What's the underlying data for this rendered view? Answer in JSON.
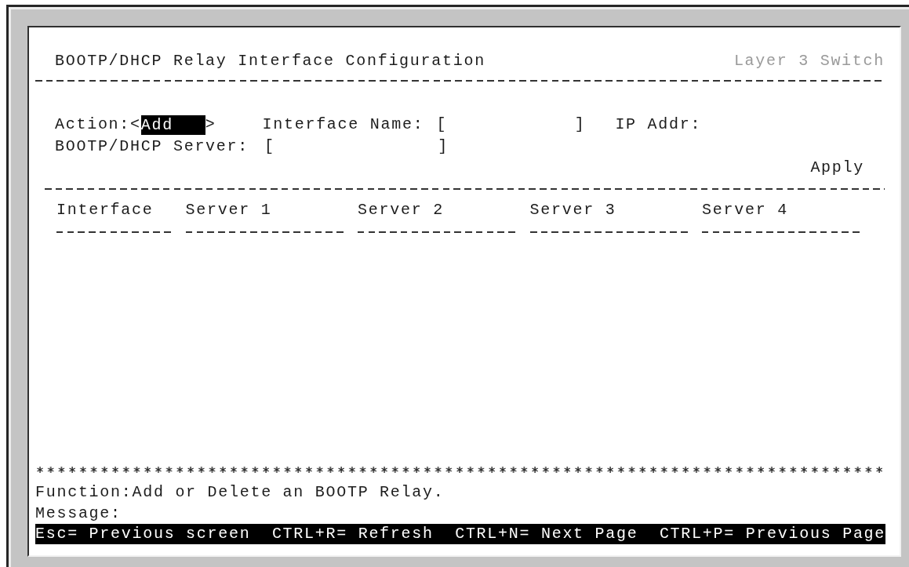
{
  "screen": {
    "title": "BOOTP/DHCP Relay Interface Configuration",
    "device": "Layer 3 Switch"
  },
  "form": {
    "action": {
      "label": "Action:",
      "open": "<",
      "value": "Add",
      "close": ">",
      "focused": true
    },
    "interface_name": {
      "label": "Interface Name:",
      "open_bracket": "[",
      "close_bracket": "]"
    },
    "ip_addr": {
      "label": "IP Addr:"
    },
    "server": {
      "label": "BOOTP/DHCP Server:",
      "open_bracket": "[",
      "close_bracket": "]"
    },
    "apply_button": "Apply"
  },
  "table": {
    "columns": [
      "Interface",
      "Server 1",
      "Server 2",
      "Server 3",
      "Server 4"
    ]
  },
  "function_text": "Function:Add or Delete an BOOTP Relay.",
  "message": {
    "label": "Message:"
  },
  "key_hints": [
    "Esc= Previous screen",
    "CTRL+R= Refresh",
    "CTRL+N= Next Page",
    "CTRL+P= Previous Page"
  ]
}
